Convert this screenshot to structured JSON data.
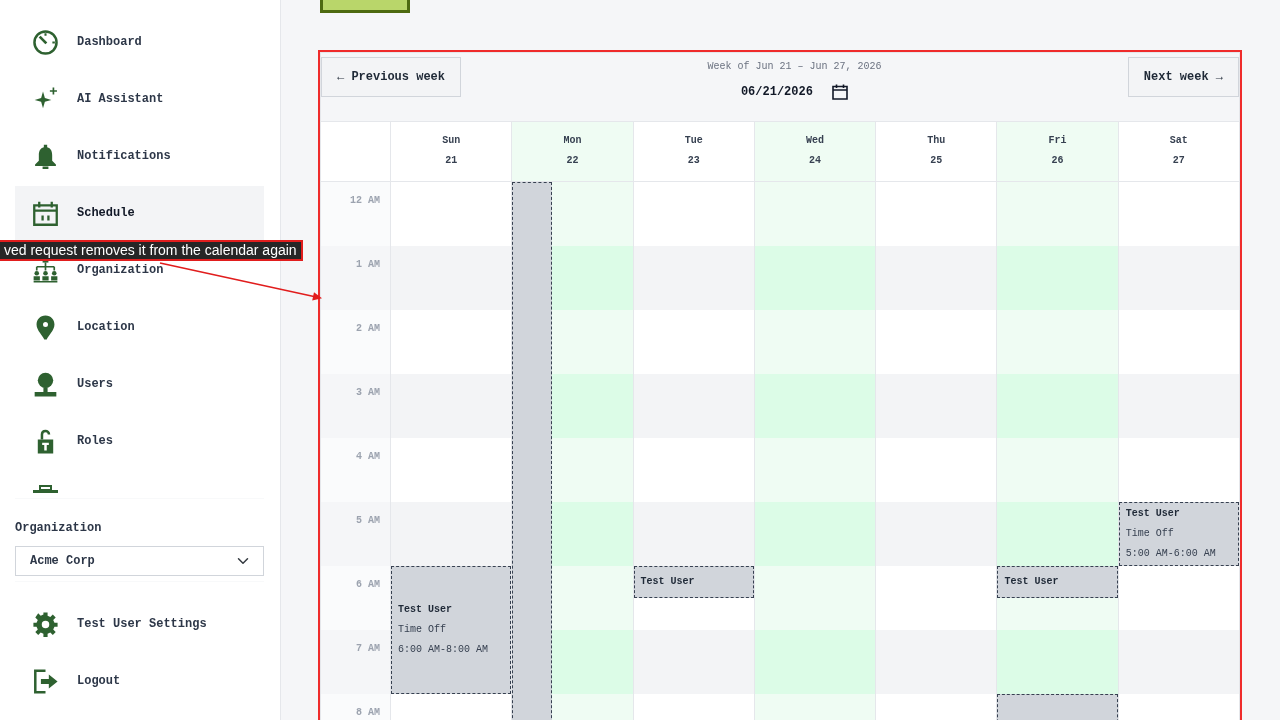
{
  "sidebar": {
    "nav": [
      {
        "label": "Dashboard",
        "selected": false
      },
      {
        "label": "AI Assistant",
        "selected": false
      },
      {
        "label": "Notifications",
        "selected": false
      },
      {
        "label": "Schedule",
        "selected": true
      },
      {
        "label": "Organization",
        "selected": false
      },
      {
        "label": "Location",
        "selected": false
      },
      {
        "label": "Users",
        "selected": false
      },
      {
        "label": "Roles",
        "selected": false
      }
    ],
    "organization": {
      "label": "Organization",
      "value": "Acme Corp"
    },
    "footer": [
      {
        "label": "Test User Settings"
      },
      {
        "label": "Logout"
      }
    ]
  },
  "calendar": {
    "previous": "← Previous week",
    "range": "Week of Jun 21 – Jun 27, 2026",
    "date": "06/21/2026",
    "next": "Next week →",
    "days": [
      {
        "name": "Sun",
        "date": "21",
        "shaded": false
      },
      {
        "name": "Mon",
        "date": "22",
        "shaded": true
      },
      {
        "name": "Tue",
        "date": "23",
        "shaded": false
      },
      {
        "name": "Wed",
        "date": "24",
        "shaded": true
      },
      {
        "name": "Thu",
        "date": "25",
        "shaded": false
      },
      {
        "name": "Fri",
        "date": "26",
        "shaded": true
      },
      {
        "name": "Sat",
        "date": "27",
        "shaded": false
      }
    ],
    "rows": [
      {
        "label": "12 AM",
        "cells": [
          {},
          {
            "events": [
              {
                "kind": "open",
                "narrow": true
              }
            ]
          },
          {},
          {},
          {},
          {},
          {}
        ]
      },
      {
        "label": "1 AM",
        "cells": [
          {},
          {},
          {},
          {},
          {},
          {},
          {}
        ]
      },
      {
        "label": "2 AM",
        "cells": [
          {},
          {},
          {},
          {},
          {},
          {},
          {}
        ]
      },
      {
        "label": "3 AM",
        "cells": [
          {},
          {},
          {},
          {},
          {},
          {},
          {}
        ]
      },
      {
        "label": "4 AM",
        "cells": [
          {},
          {},
          {},
          {},
          {},
          {},
          {}
        ]
      },
      {
        "label": "5 AM",
        "cells": [
          {},
          {},
          {},
          {},
          {},
          {},
          {
            "events": [
              {
                "title": "Test User",
                "type": "Time Off",
                "time": "5:00 AM-6:00 AM",
                "kind": "hour",
                "narrow": false
              }
            ]
          }
        ]
      },
      {
        "label": "6 AM",
        "cells": [
          {
            "events": [
              {
                "title": "Test User",
                "type": "Time Off",
                "time": "6:00 AM-8:00 AM",
                "kind": "double",
                "narrow": false
              }
            ]
          },
          {},
          {
            "events": [
              {
                "title": "Test User",
                "kind": "half",
                "narrow": false
              }
            ]
          },
          {},
          {},
          {
            "events": [
              {
                "title": "Test User",
                "kind": "half",
                "narrow": false
              }
            ]
          },
          {}
        ]
      },
      {
        "label": "7 AM",
        "cells": [
          {},
          {},
          {},
          {},
          {},
          {},
          {}
        ]
      },
      {
        "label": "8 AM",
        "cells": [
          {},
          {},
          {},
          {},
          {},
          {
            "events": [
              {
                "kind": "open",
                "narrow": false
              }
            ]
          },
          {}
        ]
      }
    ]
  },
  "annotation": {
    "text": "ved request removes it from the calendar again"
  }
}
